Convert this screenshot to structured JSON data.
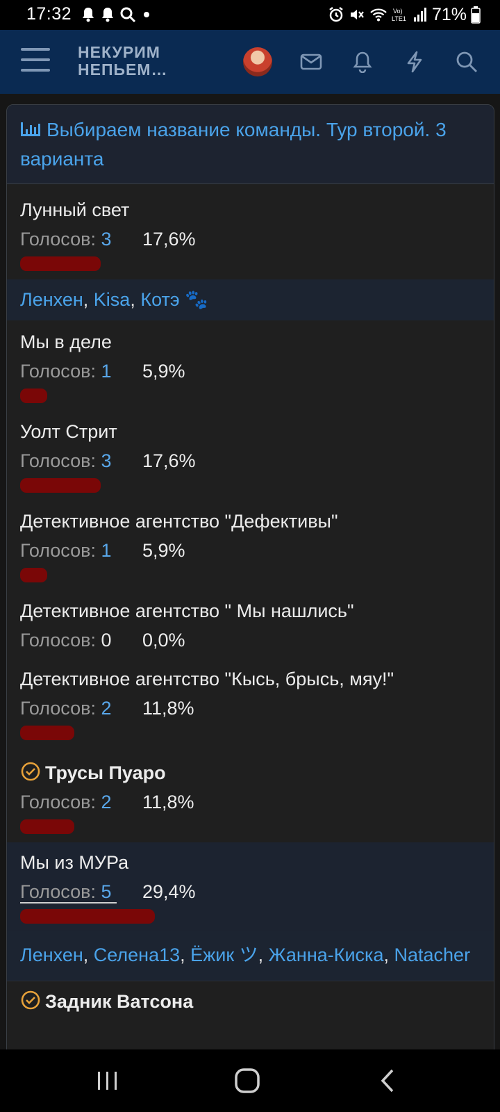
{
  "status": {
    "time": "17:32",
    "battery": "71%",
    "left_icons": [
      "notification-bell-icon",
      "notification-bell-icon",
      "search-notification-icon",
      "dot-icon"
    ],
    "right_icons": [
      "alarm-icon",
      "mute-icon",
      "wifi-icon",
      "volte-icon",
      "signal-icon",
      "battery-icon"
    ]
  },
  "header": {
    "logo_line1": "НЕКУРИМ",
    "logo_line2": "НЕПЬЕМ…",
    "icons": [
      "menu-icon",
      "avatar",
      "mail-icon",
      "bell-icon",
      "lightning-icon",
      "search-icon"
    ]
  },
  "poll": {
    "title": "Выбираем название команды. Тур второй. 3 варианта",
    "options": [
      {
        "name": "Лунный свет",
        "votes_label": "Голосов:",
        "votes": "3",
        "pct": "17,6%",
        "fraction": 0.176,
        "voters": [
          "Ленхен",
          "Kisa",
          "Котэ 🐾"
        ]
      },
      {
        "name": "Мы в деле",
        "votes_label": "Голосов:",
        "votes": "1",
        "pct": "5,9%",
        "fraction": 0.059
      },
      {
        "name": "Уолт Стрит",
        "votes_label": "Голосов:",
        "votes": "3",
        "pct": "17,6%",
        "fraction": 0.176
      },
      {
        "name": "Детективное агентство \"Дефективы\"",
        "votes_label": "Голосов:",
        "votes": "1",
        "pct": "5,9%",
        "fraction": 0.059
      },
      {
        "name": "Детективное агентство \" Мы нашлись\"",
        "votes_label": "Голосов:",
        "votes": "0",
        "pct": "0,0%",
        "fraction": 0
      },
      {
        "name": "Детективное агентство \"Кысь, брысь, мяу!\"",
        "votes_label": "Голосов:",
        "votes": "2",
        "pct": "11,8%",
        "fraction": 0.118
      },
      {
        "name": "Трусы Пуаро",
        "votes_label": "Голосов:",
        "votes": "2",
        "pct": "11,8%",
        "fraction": 0.118,
        "winner": true
      },
      {
        "name": "Мы из МУРа",
        "votes_label": "Голосов:",
        "votes": "5",
        "pct": "29,4%",
        "fraction": 0.294,
        "voters": [
          "Ленхен",
          "Селена13",
          "Ёжик ツ",
          "Жанна-Киска",
          "Natacher"
        ]
      },
      {
        "name": "Задник Ватсона",
        "winner": true
      }
    ]
  },
  "navbar": {
    "icons": [
      "recent-apps-icon",
      "home-icon",
      "back-icon"
    ]
  }
}
